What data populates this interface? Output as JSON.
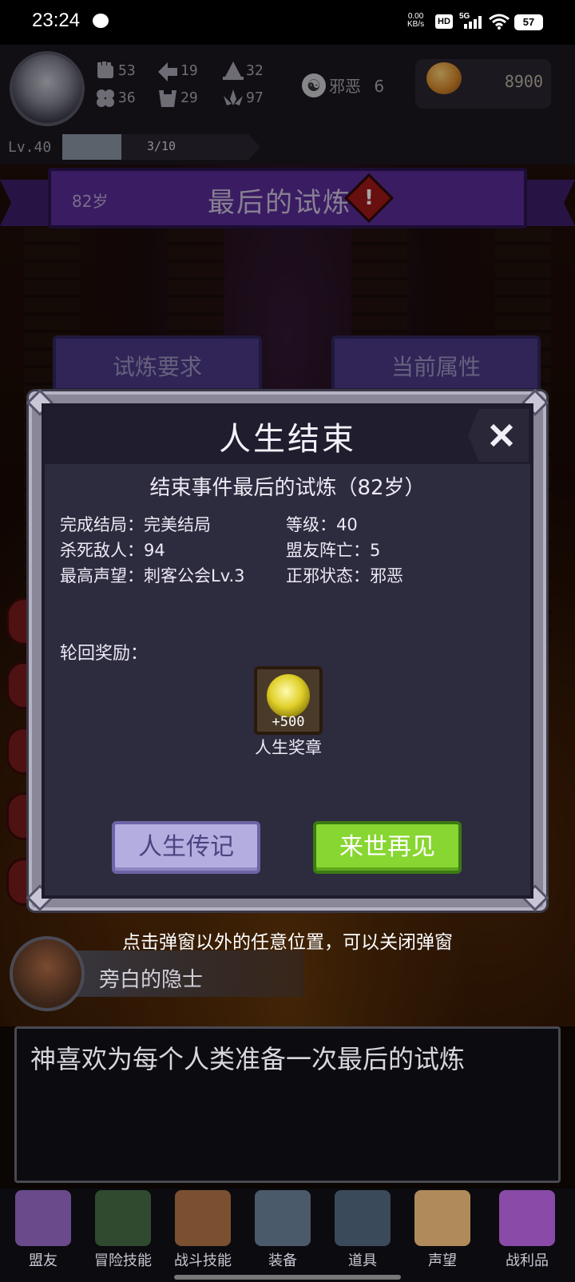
{
  "status_bar": {
    "time": "23:24",
    "net_speed_value": "0.00",
    "net_speed_unit": "KB/s",
    "hd": "HD",
    "signal": "5G",
    "battery": "57"
  },
  "player": {
    "stats": [
      {
        "icon": "fist-icon",
        "value": "53"
      },
      {
        "icon": "arrow-icon",
        "value": "19"
      },
      {
        "icon": "wizard-hat-icon",
        "value": "32"
      },
      {
        "icon": "clover-icon",
        "value": "36"
      },
      {
        "icon": "armor-icon",
        "value": "29"
      },
      {
        "icon": "lotus-icon",
        "value": "97"
      }
    ],
    "alignment_label": "邪恶",
    "alignment_value": "6",
    "gold": "8900",
    "level_label": "Lv.40",
    "xp_text": "3/10",
    "xp_fraction": 0.3
  },
  "event": {
    "age": "82岁",
    "title": "最后的试炼"
  },
  "tabs": {
    "requirements": "试炼要求",
    "attributes": "当前属性"
  },
  "modal": {
    "title": "人生结束",
    "summary": "结束事件最后的试炼（82岁）",
    "info": [
      {
        "label": "完成结局：完美结局"
      },
      {
        "label": "等级：40"
      },
      {
        "label": "杀死敌人：94"
      },
      {
        "label": "盟友阵亡：5"
      },
      {
        "label": "最高声望：刺客公会Lv.3"
      },
      {
        "label": "正邪状态：邪恶"
      }
    ],
    "reward_label": "轮回奖励：",
    "reward": {
      "qty": "+500",
      "name": "人生奖章"
    },
    "btn_legend": "人生传记",
    "btn_next": "来世再见"
  },
  "hint": "点击弹窗以外的任意位置，可以关闭弹窗",
  "narrator": {
    "name": "旁白的隐士",
    "text": "神喜欢为每个人类准备一次最后的试炼"
  },
  "nav": [
    {
      "label": "盟友",
      "icon": "handshake-icon",
      "color": "#6a4a8a"
    },
    {
      "label": "冒险技能",
      "icon": "book-icon",
      "color": "#2f4a2f"
    },
    {
      "label": "战斗技能",
      "icon": "backpack-icon",
      "color": "#7a5030"
    },
    {
      "label": "装备",
      "icon": "swords-icon",
      "color": "#4a5a6a"
    },
    {
      "label": "道具",
      "icon": "bag-icon",
      "color": "#3a4a5a"
    },
    {
      "label": "声望",
      "icon": "scroll-icon",
      "color": "#b08a5a"
    },
    {
      "label": "战利品",
      "icon": "chest-icon",
      "color": "#8a4aa8"
    }
  ]
}
